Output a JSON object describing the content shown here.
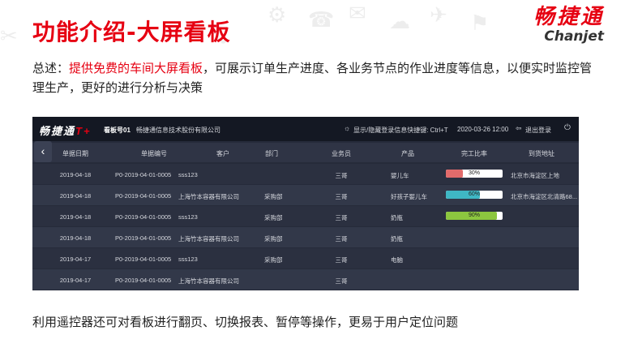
{
  "slide": {
    "title": "功能介绍-大屏看板",
    "brand_cn": "畅捷通",
    "brand_en": "Chanjet",
    "summary_prefix": "总述：",
    "summary_highlight": "提供免费的车间大屏看板",
    "summary_rest": "，可展示订单生产进度、各业务节点的作业进度等信息，以便实时监控管理生产，更好的进行分析与决策",
    "footer": "利用遥控器还可对看板进行翻页、切换报表、暂停等操作，更易于用户定位问题"
  },
  "board": {
    "logo": "畅捷通",
    "logo_t": "T+",
    "board_no": "看板号01",
    "company": "畅捷通信息技术股份有限公司",
    "hint": "显示/隐藏登录信息快捷键: Ctrl+T",
    "datetime": "2020-03-26 12:00",
    "logout": "退出登录",
    "columns": [
      "单据日期",
      "单据编号",
      "客户",
      "部门",
      "业务员",
      "产品",
      "完工比率",
      "到货地址"
    ],
    "rows": [
      {
        "date": "2019-04-18",
        "code": "P0-2019-04-01-0005",
        "customer": "sss123",
        "dept": "",
        "staff": "三哥",
        "product": "婴儿车",
        "ratio": 0.3,
        "ratio_label": "30%",
        "ratio_color": "#e26b6b",
        "address": "北京市海淀区上地"
      },
      {
        "date": "2019-04-18",
        "code": "P0-2019-04-01-0005",
        "customer": "上海竹本容器有限公司",
        "dept": "采购部",
        "staff": "三哥",
        "product": "好孩子婴儿车",
        "ratio": 0.6,
        "ratio_label": "60%",
        "ratio_color": "#3fb7c4",
        "address": "北京市海淀区北清路68..."
      },
      {
        "date": "2019-04-18",
        "code": "P0-2019-04-01-0005",
        "customer": "sss123",
        "dept": "采购部",
        "staff": "三哥",
        "product": "奶瓶",
        "ratio": 0.9,
        "ratio_label": "90%",
        "ratio_color": "#8cc63f",
        "address": ""
      },
      {
        "date": "2019-04-18",
        "code": "P0-2019-04-01-0005",
        "customer": "上海竹本容器有限公司",
        "dept": "采购部",
        "staff": "三哥",
        "product": "奶瓶",
        "ratio": null,
        "ratio_label": "",
        "ratio_color": "",
        "address": ""
      },
      {
        "date": "2019-04-17",
        "code": "P0-2019-04-01-0005",
        "customer": "sss123",
        "dept": "采购部",
        "staff": "三哥",
        "product": "电脑",
        "ratio": null,
        "ratio_label": "",
        "ratio_color": "",
        "address": ""
      },
      {
        "date": "2019-04-17",
        "code": "P0-2019-04-01-0005",
        "customer": "上海竹本容器有限公司",
        "dept": "",
        "staff": "三哥",
        "product": "",
        "ratio": null,
        "ratio_label": "",
        "ratio_color": "",
        "address": ""
      }
    ]
  },
  "icons": {
    "hint": "lightbulb-icon",
    "logout": "logout-icon",
    "power": "power-icon",
    "back": "chevron-left-icon"
  },
  "colors": {
    "accent": "#e60012",
    "board_bg": "#262b3a",
    "topbar_bg": "#141823"
  }
}
